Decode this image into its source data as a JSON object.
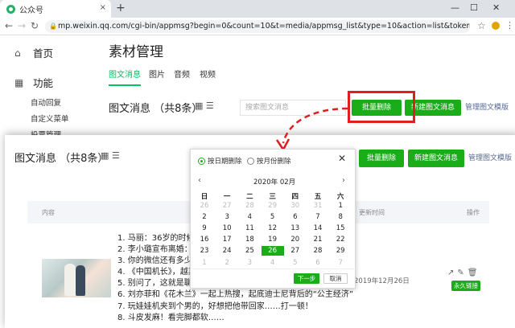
{
  "browser": {
    "tab_title": "公众号",
    "tab_close": "×",
    "new_tab": "+",
    "window_controls": [
      "—",
      "☐",
      "✕"
    ],
    "url": "mp.weixin.qq.com/cgi-bin/appmsg?begin=0&count=10&t=media/appmsg_list&type=10&action=list&token=1159857303&lan..."
  },
  "sidebar": {
    "home_label": "首页",
    "func_label": "功能",
    "sub_items": [
      "自动回复",
      "自定义菜单",
      "投票管理"
    ]
  },
  "main": {
    "title": "素材管理",
    "tabs": [
      {
        "label": "图文消息",
        "active": true
      },
      {
        "label": "图片",
        "active": false
      },
      {
        "label": "音频",
        "active": false
      },
      {
        "label": "视频",
        "active": false
      }
    ],
    "count_label": "图文消息  （共8条）",
    "search_placeholder": "搜索图文消息",
    "batch_delete": "批量删除",
    "new_article": "新建图文消息",
    "manage_templates": "管理图文模版"
  },
  "card": {
    "count_label": "图文消息  （共8条）",
    "batch_delete": "批量删除",
    "new_article": "新建图文消息",
    "manage_templates": "管理图文模版",
    "columns": {
      "content": "内容",
      "updated": "更新时间",
      "actions": "操作"
    },
    "article_lines": [
      "1. 马丽：36岁的时候，",
      "2. 李小璐宣布离婚：“依",
      "3. 你的微信还有多少个",
      "4. 《中国机长》，越真",
      "5. 别问了，这就是聊天",
      "6. 刘亦菲和《花木兰》一起上热搜，起底迪士尼背后的“公主经济”",
      "7. 玩娃娃机夹到个男的，好想把他带回家……打一顿！",
      "8. 斗皮发麻！看完脚都软……"
    ],
    "updated_date": "2019年12月26日",
    "permanent_link": "永久链接",
    "action_icons": [
      "share-icon",
      "edit-icon",
      "trash-icon"
    ]
  },
  "popup": {
    "option_by_date": "按日期删除",
    "option_by_month": "按月份删除",
    "selected_option": "按日期删除",
    "close": "✕",
    "month_label": "2020年 02月",
    "prev": "‹",
    "next": "›",
    "weekdays": [
      "日",
      "一",
      "二",
      "三",
      "四",
      "五",
      "六"
    ],
    "weeks": [
      [
        [
          "26",
          "dim"
        ],
        [
          "27",
          "dim"
        ],
        [
          "28",
          "dim"
        ],
        [
          "29",
          "dim"
        ],
        [
          "30",
          "dim"
        ],
        [
          "31",
          "dim"
        ],
        [
          "1",
          "cur"
        ]
      ],
      [
        [
          "2",
          "cur"
        ],
        [
          "3",
          "cur"
        ],
        [
          "4",
          "cur"
        ],
        [
          "5",
          "cur"
        ],
        [
          "6",
          "cur"
        ],
        [
          "7",
          "cur"
        ],
        [
          "8",
          "cur"
        ]
      ],
      [
        [
          "9",
          "cur"
        ],
        [
          "10",
          "cur"
        ],
        [
          "11",
          "cur"
        ],
        [
          "12",
          "cur"
        ],
        [
          "13",
          "cur"
        ],
        [
          "14",
          "cur"
        ],
        [
          "15",
          "cur"
        ]
      ],
      [
        [
          "16",
          "cur"
        ],
        [
          "17",
          "cur"
        ],
        [
          "18",
          "cur"
        ],
        [
          "19",
          "cur"
        ],
        [
          "20",
          "cur"
        ],
        [
          "21",
          "cur"
        ],
        [
          "22",
          "cur"
        ]
      ],
      [
        [
          "23",
          "cur"
        ],
        [
          "24",
          "cur"
        ],
        [
          "25",
          "cur"
        ],
        [
          "26",
          "sel"
        ],
        [
          "27",
          "cur"
        ],
        [
          "28",
          "cur"
        ],
        [
          "29",
          "cur"
        ]
      ],
      [
        [
          "1",
          "dim"
        ],
        [
          "2",
          "dim"
        ],
        [
          "3",
          "dim"
        ],
        [
          "4",
          "dim"
        ],
        [
          "5",
          "dim"
        ],
        [
          "6",
          "dim"
        ],
        [
          "7",
          "dim"
        ]
      ]
    ],
    "selected_day": "26",
    "next_step": "下一步",
    "cancel": "取消"
  },
  "colors": {
    "accent": "#1aad19",
    "highlight": "#e01e1e",
    "link": "#576b95"
  }
}
